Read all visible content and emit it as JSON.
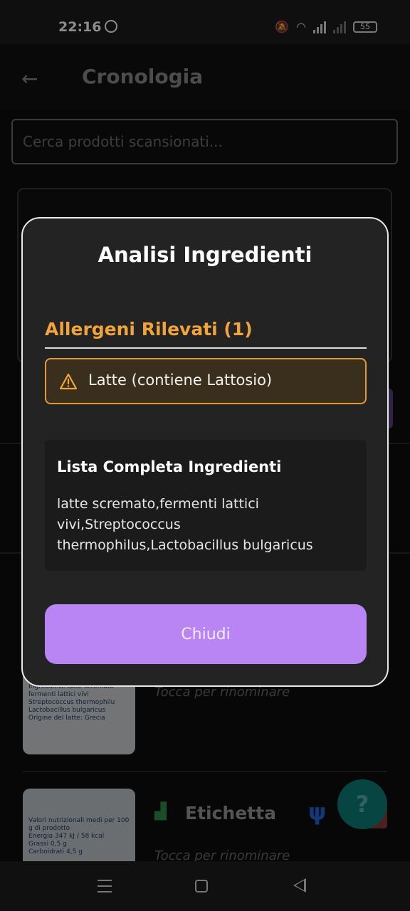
{
  "status_bar": {
    "time": "22:16",
    "battery": "55"
  },
  "app_bar": {
    "back_icon": "arrow-left-icon",
    "title": "Cronologia"
  },
  "search": {
    "placeholder": "Cerca prodotti scansionati..."
  },
  "background": {
    "rename_hint": "Tocca per rinominare",
    "item2_label": "Etichetta",
    "help_symbol": "?",
    "chart_icon": "bar-chart-icon",
    "fork_icon": "fork-knife-icon"
  },
  "dialog": {
    "title": "Analisi Ingredienti",
    "allergens_heading": "Allergeni Rilevati (1)",
    "allergens": [
      {
        "text": "Latte (contiene Lattosio)",
        "icon": "warning-icon"
      }
    ],
    "ingredients_heading": "Lista Completa Ingredienti",
    "ingredients_text": "latte scremato,fermenti lattici vivi,Streptococcus thermophilus,Lactobacillus bulgaricus",
    "close_label": "Chiudi"
  },
  "colors": {
    "allergen": "#f0a43a",
    "accent": "#b985f5",
    "dialog_bg": "#232323"
  }
}
